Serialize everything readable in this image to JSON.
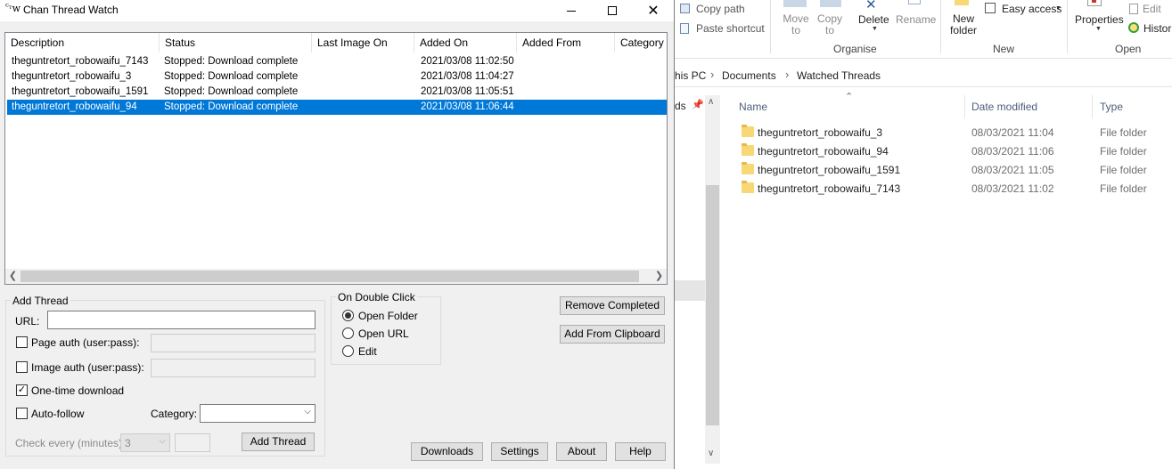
{
  "explorer": {
    "ribbon": {
      "copy_path": "Copy path",
      "paste_shortcut": "Paste shortcut",
      "move_to": "Move to",
      "copy_to": "Copy to",
      "delete": "Delete",
      "rename": "Rename",
      "new_folder": "New folder",
      "easy_access": "Easy access",
      "properties": "Properties",
      "edit": "Edit",
      "history": "Histor",
      "groups": {
        "organise": "Organise",
        "new": "New",
        "open": "Open"
      }
    },
    "breadcrumb": [
      "his PC",
      "Documents",
      "Watched Threads"
    ],
    "nav_pane_item": "ds",
    "columns": {
      "name": "Name",
      "date_modified": "Date modified",
      "type": "Type"
    },
    "files": [
      {
        "name": "theguntretort_robowaifu_3",
        "date": "08/03/2021 11:04",
        "type": "File folder"
      },
      {
        "name": "theguntretort_robowaifu_94",
        "date": "08/03/2021 11:06",
        "type": "File folder"
      },
      {
        "name": "theguntretort_robowaifu_1591",
        "date": "08/03/2021 11:05",
        "type": "File folder"
      },
      {
        "name": "theguntretort_robowaifu_7143",
        "date": "08/03/2021 11:02",
        "type": "File folder"
      }
    ]
  },
  "app": {
    "title": "Chan Thread Watch",
    "icon_text": "CTW",
    "columns": [
      "Description",
      "Status",
      "Last Image On",
      "Added On",
      "Added From",
      "Category"
    ],
    "threads": [
      {
        "description": "theguntretort_robowaifu_7143",
        "status": "Stopped: Download complete",
        "last_image_on": "",
        "added_on": "2021/03/08 11:02:50",
        "added_from": "",
        "category": ""
      },
      {
        "description": "theguntretort_robowaifu_3",
        "status": "Stopped: Download complete",
        "last_image_on": "",
        "added_on": "2021/03/08 11:04:27",
        "added_from": "",
        "category": ""
      },
      {
        "description": "theguntretort_robowaifu_1591",
        "status": "Stopped: Download complete",
        "last_image_on": "",
        "added_on": "2021/03/08 11:05:51",
        "added_from": "",
        "category": ""
      },
      {
        "description": "theguntretort_robowaifu_94",
        "status": "Stopped: Download complete",
        "last_image_on": "",
        "added_on": "2021/03/08 11:06:44",
        "added_from": "",
        "category": "",
        "selected": true
      }
    ],
    "add_thread": {
      "group_label": "Add Thread",
      "url_label": "URL:",
      "url_value": "",
      "page_auth_label": "Page auth (user:pass):",
      "image_auth_label": "Image auth (user:pass):",
      "one_time_label": "One-time download",
      "one_time_checked": true,
      "auto_follow_label": "Auto-follow",
      "category_label": "Category:",
      "category_value": "",
      "check_every_label": "Check every (minutes):",
      "check_every_value": "3",
      "add_button": "Add Thread"
    },
    "double_click": {
      "group_label": "On Double Click",
      "options": [
        "Open Folder",
        "Open URL",
        "Edit"
      ],
      "selected": "Open Folder"
    },
    "buttons": {
      "remove_completed": "Remove Completed",
      "add_from_clipboard": "Add From Clipboard",
      "downloads": "Downloads",
      "settings": "Settings",
      "about": "About",
      "help": "Help"
    }
  }
}
